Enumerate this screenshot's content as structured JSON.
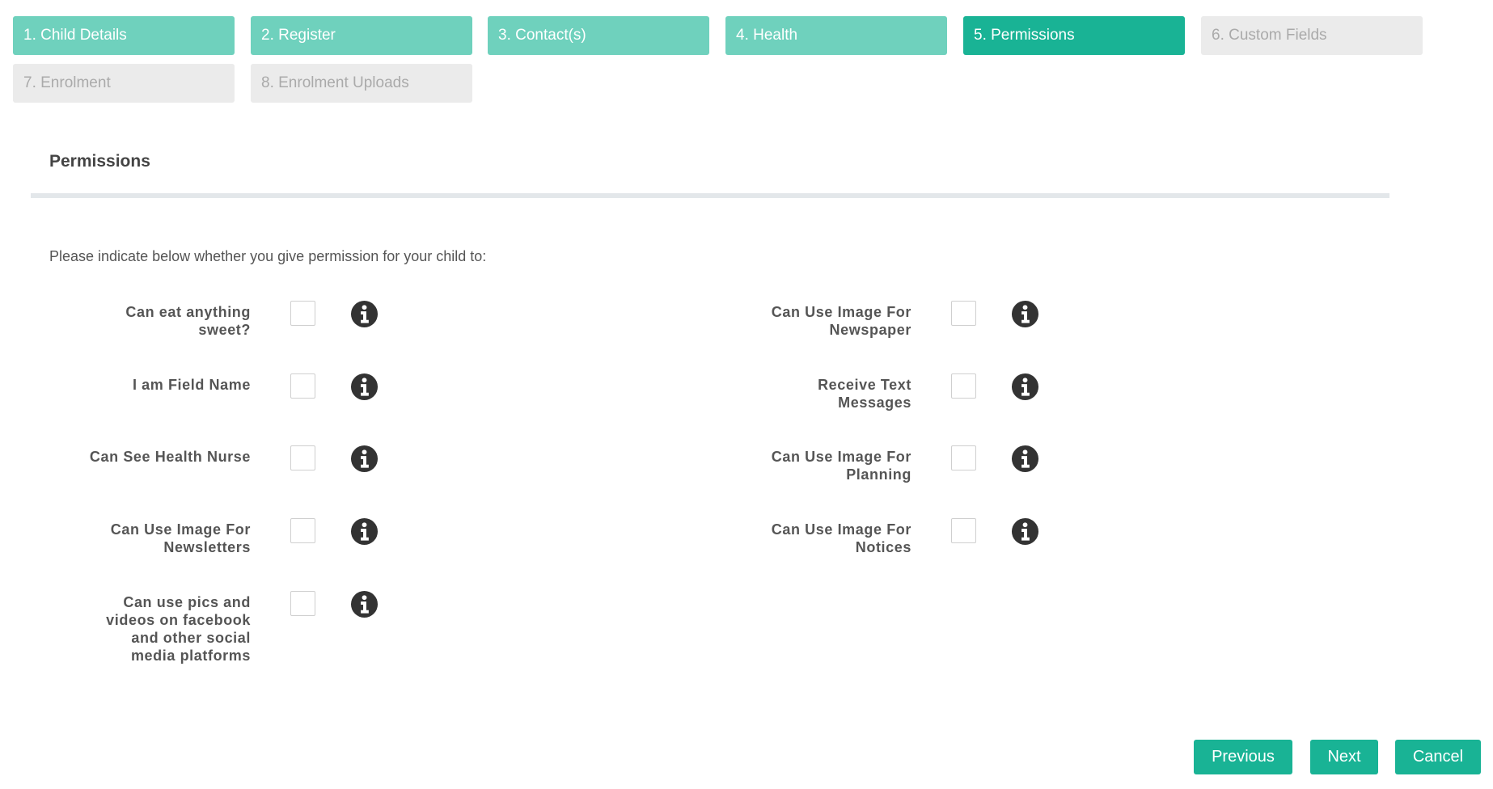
{
  "steps": [
    {
      "label": "1. Child Details",
      "state": "done"
    },
    {
      "label": "2. Register",
      "state": "done"
    },
    {
      "label": "3. Contact(s)",
      "state": "done"
    },
    {
      "label": "4. Health",
      "state": "done"
    },
    {
      "label": "5. Permissions",
      "state": "active"
    },
    {
      "label": "6. Custom Fields",
      "state": "pending"
    },
    {
      "label": "7. Enrolment",
      "state": "pending"
    },
    {
      "label": "8. Enrolment Uploads",
      "state": "pending"
    }
  ],
  "section": {
    "title": "Permissions",
    "intro": "Please indicate below whether you give permission for your child to:"
  },
  "permissions_left": [
    {
      "label": "Can eat anything sweet?",
      "checked": false
    },
    {
      "label": "I am Field Name",
      "checked": false
    },
    {
      "label": "Can See Health Nurse",
      "checked": false
    },
    {
      "label": "Can Use Image For Newsletters",
      "checked": false
    },
    {
      "label": "Can use pics and videos on facebook and other social media platforms",
      "checked": false
    }
  ],
  "permissions_right": [
    {
      "label": "Can Use Image For Newspaper",
      "checked": false
    },
    {
      "label": "Receive Text Messages",
      "checked": false
    },
    {
      "label": "Can Use Image For Planning",
      "checked": false
    },
    {
      "label": "Can Use Image For Notices",
      "checked": false
    }
  ],
  "buttons": {
    "previous": "Previous",
    "next": "Next",
    "cancel": "Cancel"
  },
  "icons": {
    "info": "info-circle-icon"
  },
  "colors": {
    "step_done": "#6fd1bd",
    "step_active": "#19b395",
    "step_pending": "#ebebeb",
    "button": "#19b395",
    "info_icon": "#333333"
  }
}
